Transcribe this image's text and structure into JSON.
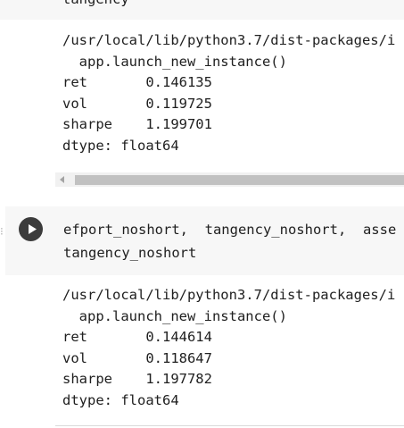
{
  "previous_cell": {
    "code_fragment": "tangency"
  },
  "output_1": {
    "lines": [
      "/usr/local/lib/python3.7/dist-packages/i",
      "  app.launch_new_instance()",
      "ret       0.146135",
      "vol       0.119725",
      "sharpe    1.199701",
      "dtype: float64"
    ]
  },
  "code_cell": {
    "lines": [
      "efport_noshort,  tangency_noshort,  asse",
      "tangency_noshort"
    ]
  },
  "output_2": {
    "lines": [
      "/usr/local/lib/python3.7/dist-packages/i",
      "  app.launch_new_instance()",
      "ret       0.144614",
      "vol       0.118647",
      "sharpe    1.197782",
      "dtype: float64"
    ]
  },
  "icons": {
    "run": "play-icon",
    "output_redirect": "output-redirect-icon",
    "scroll_left": "chevron-left-icon"
  },
  "colors": {
    "cell_background": "#f7f7f7",
    "run_button": "#3c3c3c",
    "text": "#202020",
    "scrollbar_thumb": "#c1c1c1"
  }
}
